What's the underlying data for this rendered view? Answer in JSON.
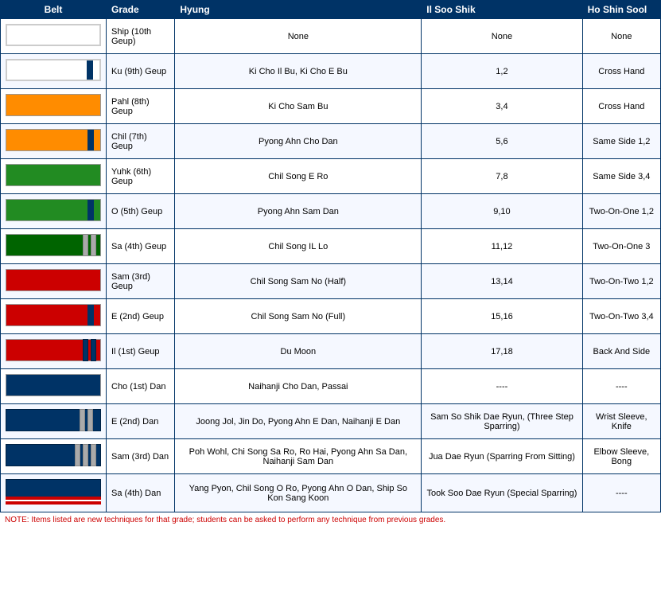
{
  "header": {
    "belt": "Belt",
    "grade": "Grade",
    "hyung": "Hyung",
    "il_soo_shik": "Il Soo Shik",
    "ho_shin_sool": "Ho Shin Sool"
  },
  "rows": [
    {
      "belt_type": "white",
      "grade": "Ship (10th Geup)",
      "hyung": "None",
      "il_soo_shik": "None",
      "ho_shin_sool": "None"
    },
    {
      "belt_type": "white-stripe",
      "grade": "Ku (9th) Geup",
      "hyung": "Ki Cho Il Bu, Ki Cho E Bu",
      "il_soo_shik": "1,2",
      "ho_shin_sool": "Cross Hand"
    },
    {
      "belt_type": "orange",
      "grade": "Pahl (8th) Geup",
      "hyung": "Ki Cho Sam Bu",
      "il_soo_shik": "3,4",
      "ho_shin_sool": "Cross Hand"
    },
    {
      "belt_type": "orange-stripe",
      "grade": "Chil (7th) Geup",
      "hyung": "Pyong Ahn Cho Dan",
      "il_soo_shik": "5,6",
      "ho_shin_sool": "Same Side 1,2"
    },
    {
      "belt_type": "green",
      "grade": "Yuhk (6th) Geup",
      "hyung": "Chil Song E Ro",
      "il_soo_shik": "7,8",
      "ho_shin_sool": "Same Side 3,4"
    },
    {
      "belt_type": "green-stripe",
      "grade": "O (5th) Geup",
      "hyung": "Pyong Ahn Sam Dan",
      "il_soo_shik": "9,10",
      "ho_shin_sool": "Two-On-One 1,2"
    },
    {
      "belt_type": "green2-2stripe",
      "grade": "Sa (4th) Geup",
      "hyung": "Chil Song IL Lo",
      "il_soo_shik": "11,12",
      "ho_shin_sool": "Two-On-One 3"
    },
    {
      "belt_type": "red",
      "grade": "Sam (3rd) Geup",
      "hyung": "Chil Song Sam No (Half)",
      "il_soo_shik": "13,14",
      "ho_shin_sool": "Two-On-Two 1,2"
    },
    {
      "belt_type": "red-stripe",
      "grade": "E (2nd) Geup",
      "hyung": "Chil Song Sam No (Full)",
      "il_soo_shik": "15,16",
      "ho_shin_sool": "Two-On-Two 3,4"
    },
    {
      "belt_type": "red-2stripe",
      "grade": "Il (1st) Geup",
      "hyung": "Du Moon",
      "il_soo_shik": "17,18",
      "ho_shin_sool": "Back And Side"
    },
    {
      "belt_type": "black",
      "grade": "Cho (1st) Dan",
      "hyung": "Naihanji Cho Dan, Passai",
      "il_soo_shik": "----",
      "ho_shin_sool": "----"
    },
    {
      "belt_type": "black-2stripe",
      "grade": "E (2nd) Dan",
      "hyung": "Joong Jol, Jin Do, Pyong Ahn E Dan, Naihanji E Dan",
      "il_soo_shik": "Sam So Shik Dae Ryun, (Three Step Sparring)",
      "ho_shin_sool": "Wrist Sleeve, Knife"
    },
    {
      "belt_type": "black-3stripe",
      "grade": "Sam (3rd) Dan",
      "hyung": "Poh Wohl, Chi Song Sa Ro, Ro Hai, Pyong Ahn Sa Dan, Naihanji Sam Dan",
      "il_soo_shik": "Jua Dae Ryun (Sparring From Sitting)",
      "ho_shin_sool": "Elbow Sleeve, Bong"
    },
    {
      "belt_type": "4dan",
      "grade": "Sa (4th) Dan",
      "hyung": "Yang Pyon, Chil Song O Ro, Pyong Ahn O Dan, Ship So Kon Sang Koon",
      "il_soo_shik": "Took Soo Dae Ryun (Special Sparring)",
      "ho_shin_sool": "----"
    }
  ],
  "note": "NOTE: Items listed are new techniques for that grade; students can be asked to perform any technique from previous grades."
}
